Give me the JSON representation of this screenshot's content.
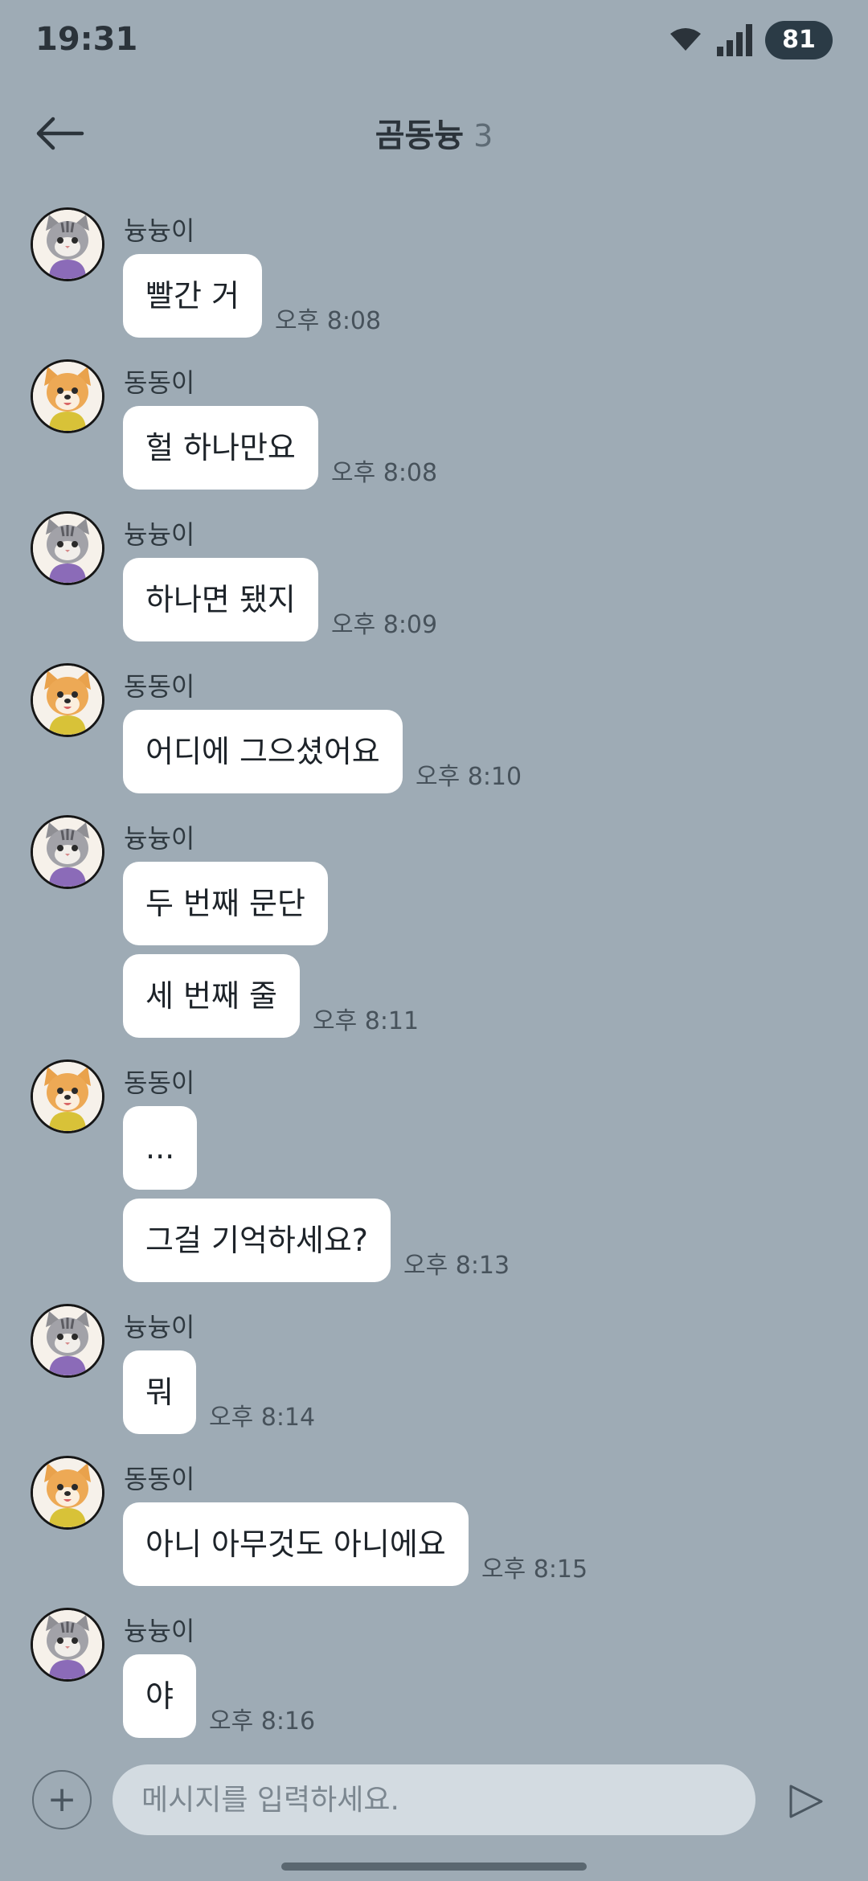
{
  "status_bar": {
    "time": "19:31",
    "battery": "81"
  },
  "header": {
    "title": "곰동늉",
    "member_count": "3",
    "back_icon": "back-arrow-icon"
  },
  "messages": [
    {
      "sender": "늉늉이",
      "avatar": "cat",
      "bubbles": [
        "빨간 거"
      ],
      "time": "오후 8:08"
    },
    {
      "sender": "동동이",
      "avatar": "dog",
      "bubbles": [
        "헐 하나만요"
      ],
      "time": "오후 8:08"
    },
    {
      "sender": "늉늉이",
      "avatar": "cat",
      "bubbles": [
        "하나면 됐지"
      ],
      "time": "오후 8:09"
    },
    {
      "sender": "동동이",
      "avatar": "dog",
      "bubbles": [
        "어디에 그으셨어요"
      ],
      "time": "오후 8:10"
    },
    {
      "sender": "늉늉이",
      "avatar": "cat",
      "bubbles": [
        "두 번째 문단",
        "세 번째 줄"
      ],
      "time": "오후 8:11"
    },
    {
      "sender": "동동이",
      "avatar": "dog",
      "bubbles": [
        "...",
        "그걸 기억하세요?"
      ],
      "time": "오후 8:13"
    },
    {
      "sender": "늉늉이",
      "avatar": "cat",
      "bubbles": [
        "뭐"
      ],
      "time": "오후 8:14"
    },
    {
      "sender": "동동이",
      "avatar": "dog",
      "bubbles": [
        "아니 아무것도 아니에요"
      ],
      "time": "오후 8:15"
    },
    {
      "sender": "늉늉이",
      "avatar": "cat",
      "bubbles": [
        "야"
      ],
      "time": "오후 8:16"
    }
  ],
  "input_bar": {
    "placeholder": "메시지를 입력하세요.",
    "plus_label": "+"
  },
  "colors": {
    "background": "#9eabb5",
    "bubble": "#ffffff",
    "input": "#d3dbe1"
  }
}
